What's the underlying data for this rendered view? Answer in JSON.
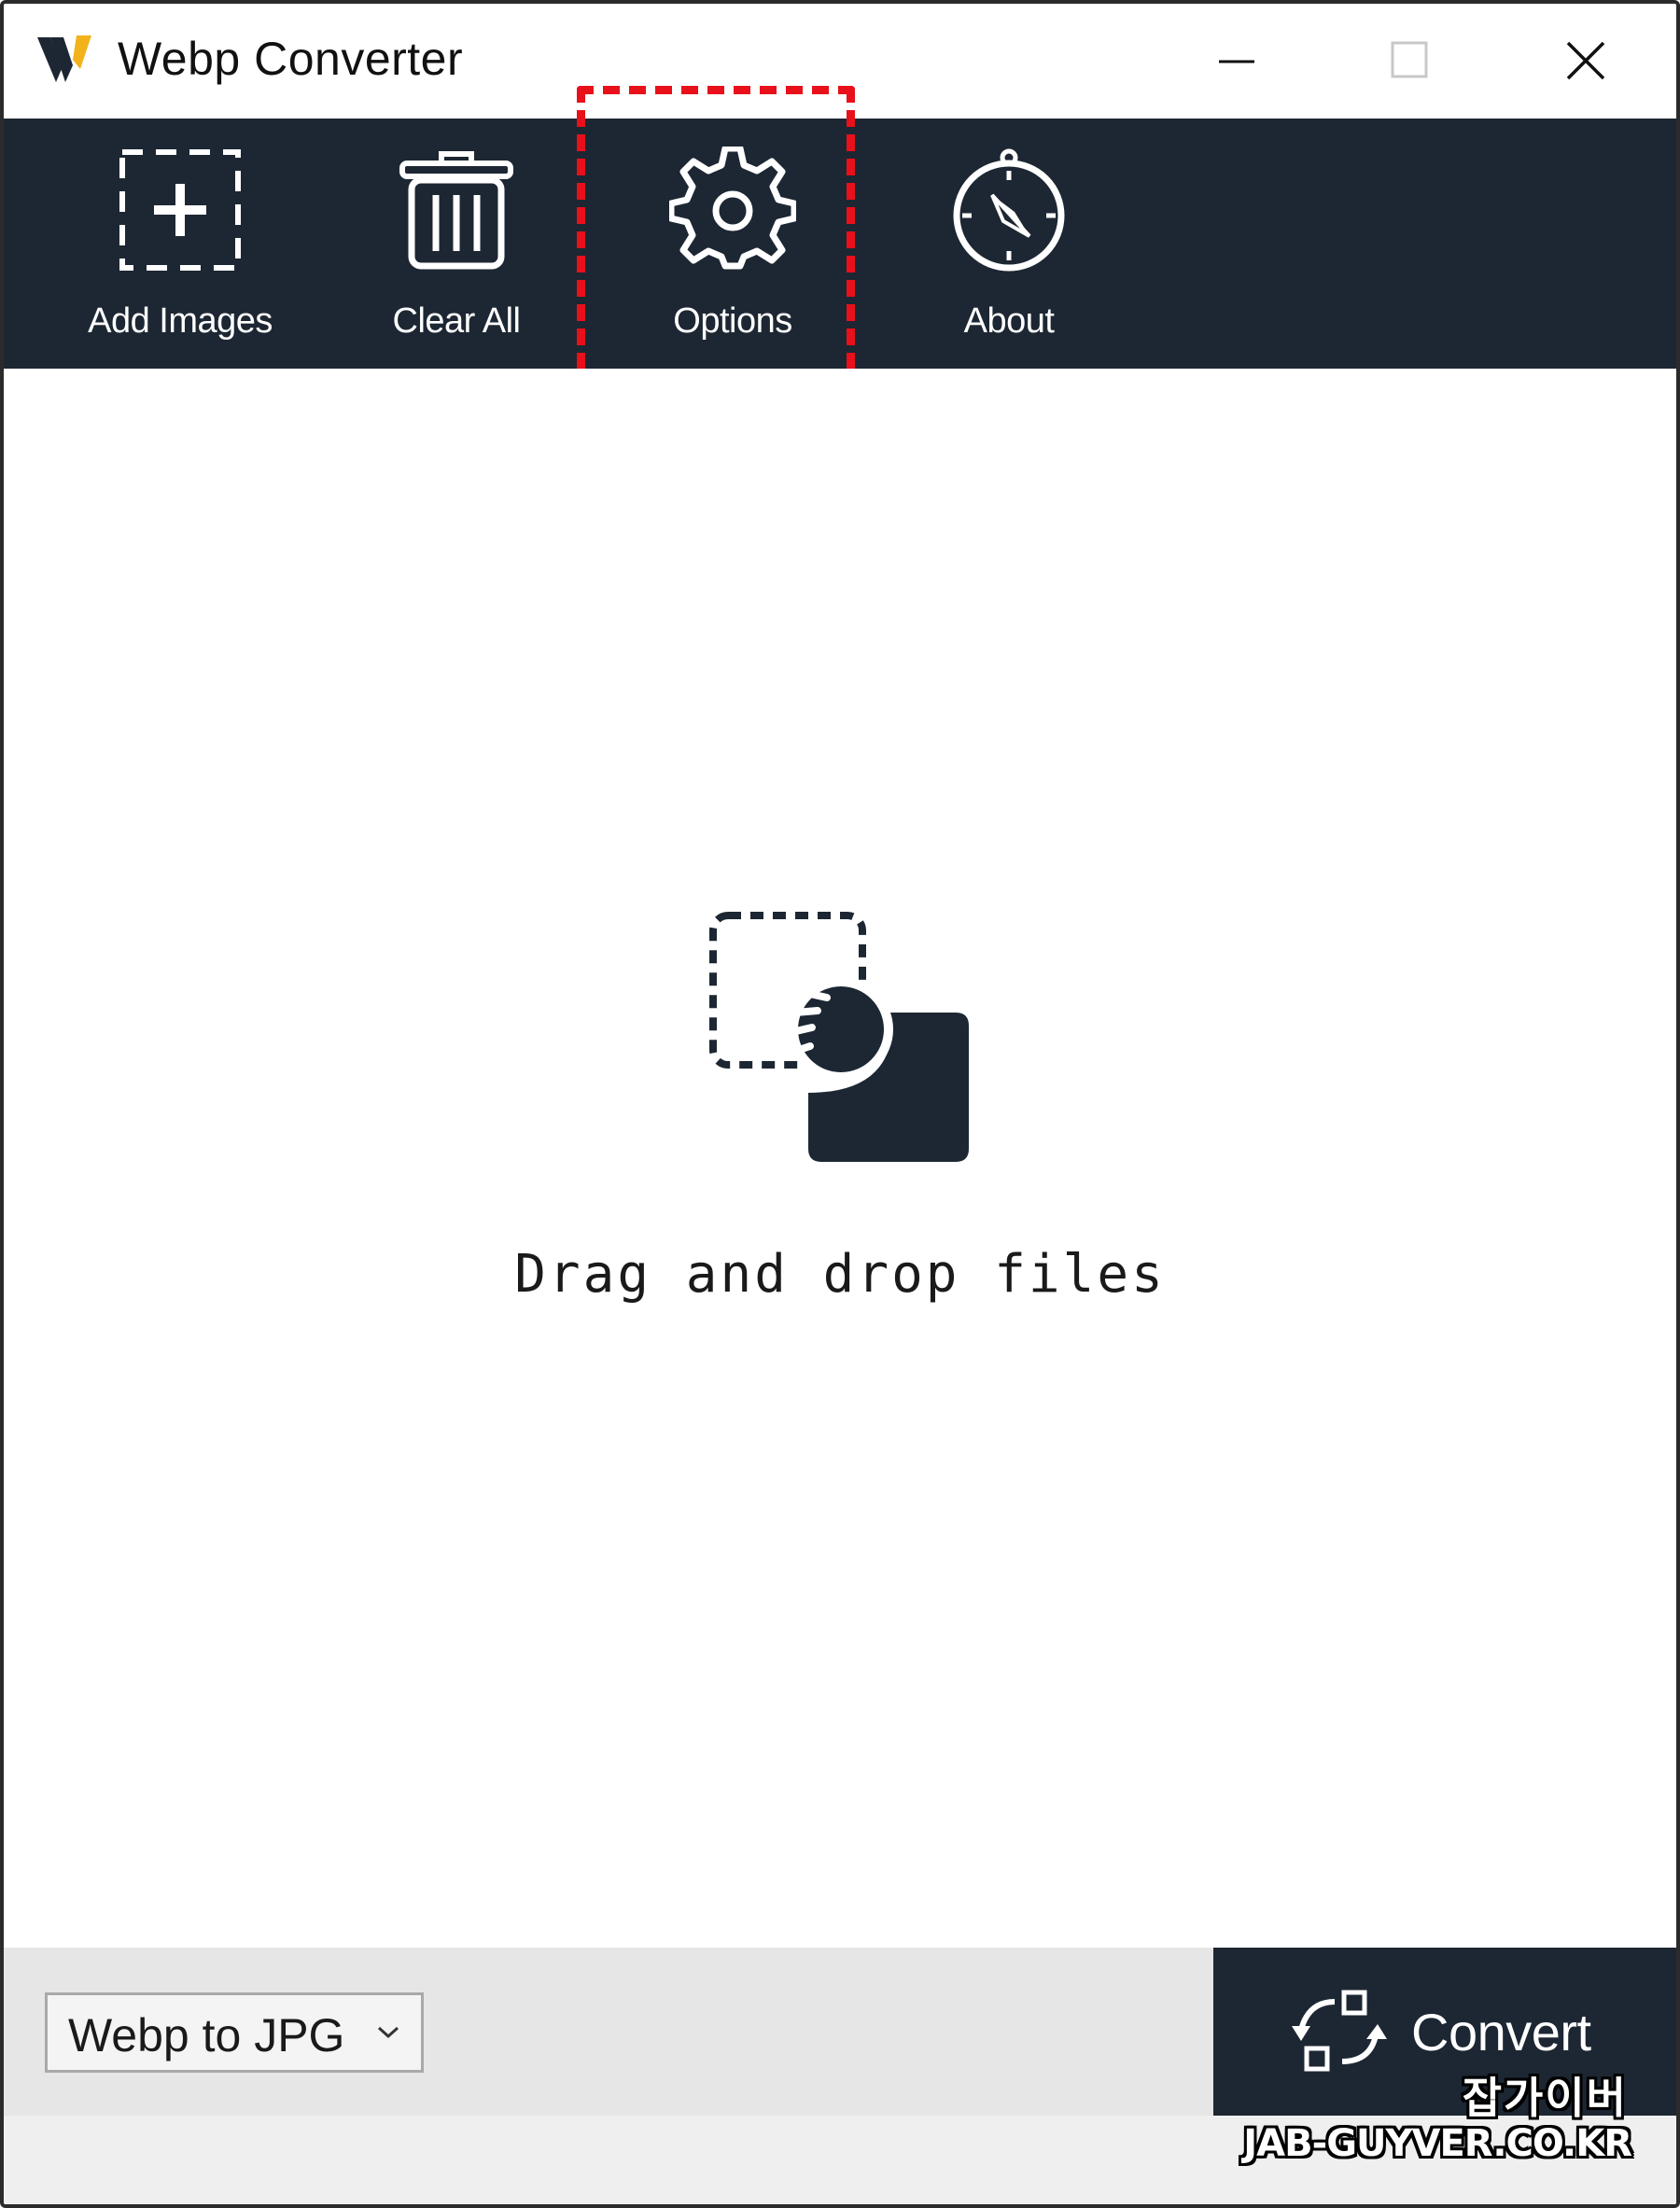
{
  "window": {
    "title": "Webp Converter"
  },
  "toolbar": {
    "items": [
      {
        "label": "Add Images",
        "icon": "add-image-icon"
      },
      {
        "label": "Clear All",
        "icon": "trash-icon"
      },
      {
        "label": "Options",
        "icon": "gear-icon"
      },
      {
        "label": "About",
        "icon": "compass-icon"
      }
    ]
  },
  "dropzone": {
    "text": "Drag and drop files",
    "icon": "drag-drop-icon"
  },
  "footer": {
    "format_selected": "Webp to JPG",
    "convert_label": "Convert",
    "convert_icon": "convert-icon"
  },
  "watermark": {
    "korean": "잡가이버",
    "site": "JAB-GUYVER.CO.KR"
  },
  "colors": {
    "toolbar_bg": "#1d2733",
    "highlight": "#e8101a",
    "footer_bg": "#e6e6e6"
  }
}
